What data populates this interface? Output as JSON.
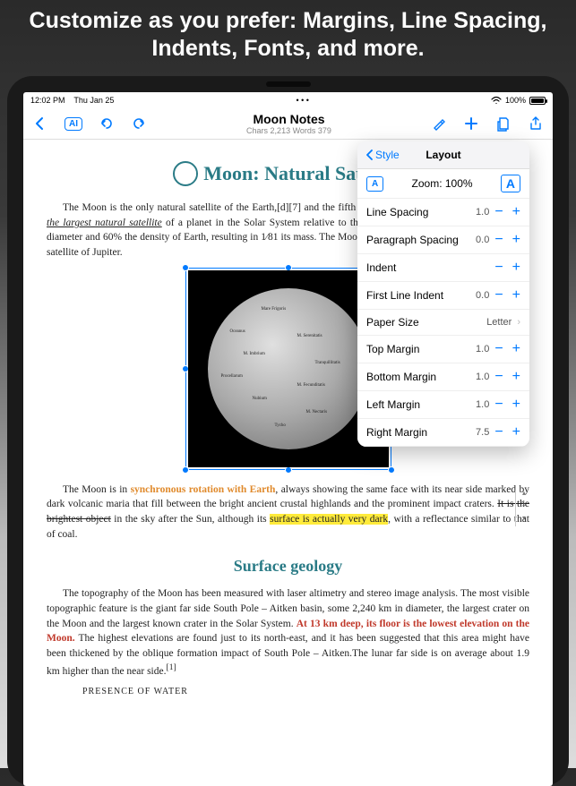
{
  "promo": "Customize as you prefer: Margins, Line Spacing, Indents, Fonts, and more.",
  "statusbar": {
    "time": "12:02 PM",
    "date": "Thu Jan 25",
    "wifi_icon": "wifi",
    "battery_pct": "100%"
  },
  "toolbar": {
    "back_icon": "chevron-left",
    "ai_label": "AI",
    "undo_icon": "undo",
    "redo_icon": "redo",
    "doc_title": "Moon Notes",
    "doc_stats": "Chars 2,213 Words 379",
    "brush_icon": "paintbrush",
    "add_icon": "plus",
    "page_icon": "doc-copy",
    "share_icon": "share"
  },
  "popover": {
    "back_label": "Style",
    "title": "Layout",
    "zoom_label": "Zoom: 100%",
    "rows": [
      {
        "label": "Line Spacing",
        "value": "1.0"
      },
      {
        "label": "Paragraph Spacing",
        "value": "0.0"
      },
      {
        "label": "Indent",
        "value": ""
      },
      {
        "label": "First Line Indent",
        "value": "0.0"
      },
      {
        "label": "Paper Size",
        "value": "Letter",
        "disclosure": true
      },
      {
        "label": "Top Margin",
        "value": "1.0"
      },
      {
        "label": "Bottom Margin",
        "value": "1.0"
      },
      {
        "label": "Left Margin",
        "value": "1.0"
      },
      {
        "label": "Right Margin",
        "value": "7.5"
      }
    ]
  },
  "content": {
    "h1": "Moon: Natural Satellite",
    "p1_a": "The Moon is the only natural satellite of the Earth,[d][7] and the fifth largest satellite in the Solar System. ",
    "p1_b": "It is the largest natural satellite",
    "p1_c": " of a planet in the Solar System relative to the size of its primary,[e] having 27% the diameter and 60% the density of Earth, resulting in 1⁄81 its mass. The Moon is the second densest satellite after Io, a satellite of Jupiter.",
    "p2_a": "The Moon is in ",
    "p2_b": "synchronous rotation with Earth",
    "p2_c": ", always showing the same face with its near side marked by dark volcanic maria that fill between the bright ancient crustal highlands and the prominent impact craters. ",
    "p2_d": "It is the brightest object",
    "p2_e": " in the sky after the Sun, although its ",
    "p2_f": "surface is actually very dark",
    "p2_g": ", with a reflectance similar to that of coal.",
    "h2": "Surface geology",
    "p3_a": "The topography of the Moon has been measured with laser altimetry and stereo image analysis. The most visible topographic feature is the giant far side South Pole – Aitken basin, some 2,240 km in diameter, the largest crater on the Moon and the largest known crater in the Solar System. ",
    "p3_b": "At 13 km deep, its floor is the lowest elevation on the Moon.",
    "p3_c": " The highest elevations are found just to its north-east, and it has been suggested that this area might have been thickened by the oblique formation impact of South Pole – Aitken.The lunar far side is on average about 1.9 km higher than the near side.",
    "p3_d": "[1]",
    "sub1": "PRESENCE OF WATER"
  },
  "scroll": {
    "page": "1"
  }
}
